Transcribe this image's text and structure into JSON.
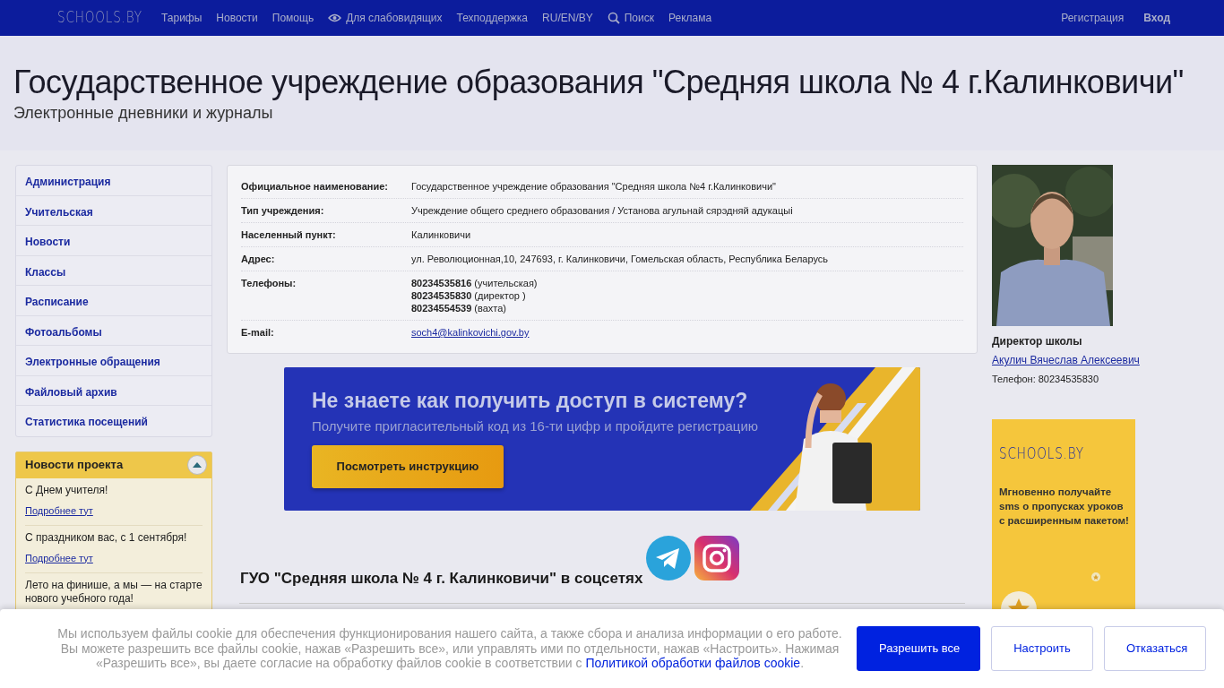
{
  "navbar": {
    "logo": "SCHOOLS.BY",
    "links": [
      {
        "label": "Тарифы",
        "kind": "text"
      },
      {
        "label": "Новости",
        "kind": "text"
      },
      {
        "label": "Помощь",
        "kind": "text"
      },
      {
        "label": "Для слабовидящих",
        "kind": "eye"
      },
      {
        "label": "Техподдержка",
        "kind": "text"
      },
      {
        "label": "RU/EN/BY",
        "kind": "text"
      },
      {
        "label": "Поиск",
        "kind": "search"
      },
      {
        "label": "Реклама",
        "kind": "text"
      }
    ],
    "right_links": [
      {
        "label": "Регистрация",
        "bold": false
      },
      {
        "label": "Вход",
        "bold": true
      }
    ]
  },
  "header": {
    "title": "Государственное учреждение образования \"Средняя школа № 4 г.Калинковичи\"",
    "subtitle": "Электронные дневники и журналы"
  },
  "sidebar": {
    "items": [
      "Администрация",
      "Учительская",
      "Новости",
      "Классы",
      "Расписание",
      "Фотоальбомы",
      "Электронные обращения",
      "Файловый архив",
      "Статистика посещений"
    ]
  },
  "news_panel": {
    "title": "Новости проекта",
    "expanded": true,
    "items": [
      {
        "text": "С Днем учителя!",
        "link": "Подробнее тут"
      },
      {
        "text": "С праздником вас, с 1 сентября!",
        "link": "Подробнее тут"
      },
      {
        "text": "Лето на финише, а мы — на старте нового учебного года!"
      }
    ]
  },
  "info": {
    "rows": [
      {
        "label": "Официальное наименование:",
        "value": "Государственное учреждение образования \"Средняя школа №4 г.Калинковичи\"",
        "kind": "text"
      },
      {
        "label": "Тип учреждения:",
        "value": "Учреждение общего среднего образования / Установа агульнай сярэдняй адукацыі",
        "kind": "text"
      },
      {
        "label": "Населенный пункт:",
        "value": "Калинковичи",
        "kind": "text"
      },
      {
        "label": "Адрес:",
        "value": "ул. Революционная,10, 247693, г. Калинковичи, Гомельская область, Республика Беларусь",
        "kind": "text"
      },
      {
        "label": "Телефоны:",
        "lines": [
          "**80234535816** (учительская)",
          "**80234535830** (директор )",
          "**80234554539** (вахта)"
        ],
        "kind": "lines"
      },
      {
        "label": "E-mail:",
        "value": "soch4@kalinkovichi.gov.by",
        "kind": "link"
      }
    ]
  },
  "banner": {
    "heading": "Не знаете как получить доступ в систему?",
    "subtitle": "Получите пригласительный код из 16-ти цифр и пройдите регистрацию",
    "button": "Посмотреть инструкцию"
  },
  "social": {
    "heading": "ГУО \"Средняя школа № 4 г. Калинковичи\" в соцсетях",
    "icons": [
      {
        "kind": "telegram"
      },
      {
        "kind": "instagram"
      }
    ]
  },
  "director": {
    "title": "Директор школы",
    "name": "Акулич Вячеслав Алексеевич",
    "phone": "Телефон: 80234535830"
  },
  "ad": {
    "logo": "SCHOOLS.BY",
    "text": "Мгновенно получайте sms о пропусках уроков с расширенным пакетом!"
  },
  "cookie": {
    "text": "Мы используем файлы cookie для обеспечения функционирования нашего сайта, а также сбора и анализа информации о его работе. Вы можете разрешить все файлы cookie, нажав «Разрешить все», или управлять ими по отдельности, нажав «Настроить». Нажимая «Разрешить все», вы даете согласие на обработку файлов cookie в соответствии с",
    "link": "Политикой обработки файлов cookie",
    "tail": ".",
    "buttons": [
      {
        "label": "Разрешить все",
        "primary": true
      },
      {
        "label": "Настроить",
        "primary": false
      },
      {
        "label": "Отказаться",
        "primary": false
      }
    ]
  }
}
